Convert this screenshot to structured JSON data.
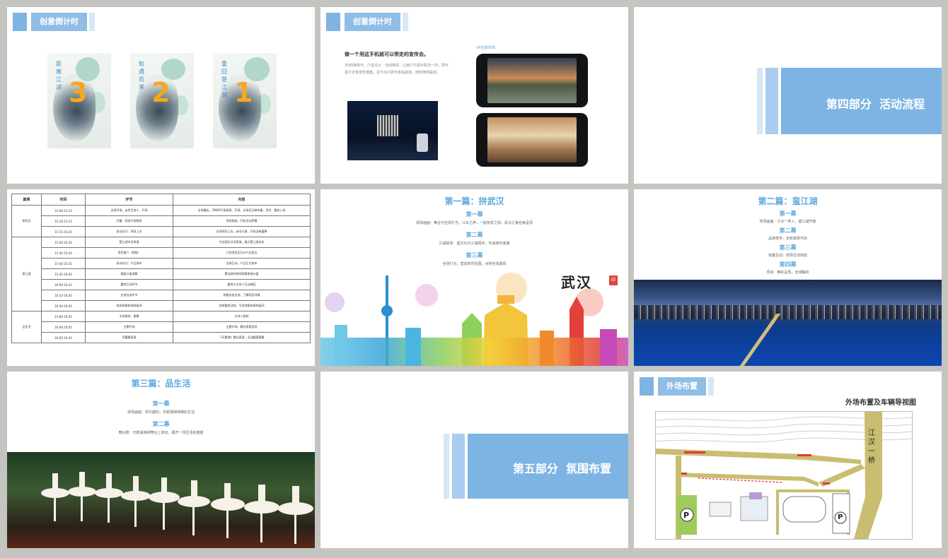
{
  "slide1": {
    "tag": "创意倒计时",
    "cards": [
      {
        "number": "3",
        "vtext": "距离江湖"
      },
      {
        "number": "2",
        "vtext": "知遇而来"
      },
      {
        "number": "1",
        "vtext": "重回楚江湖"
      }
    ]
  },
  "slide2": {
    "tag": "创意倒计时",
    "headline": "做一个用这手机就可以带走的宣传会。",
    "body": "3D的特效与、户型设计、活动等现，让用户只需手机扫一扫，即可进行全景浏览楼盘，足不出户即可身临其境，随时随地看房。",
    "phone_caption": "VR全景现场"
  },
  "slide3": {
    "title": "第四部分  活动流程"
  },
  "slide4": {
    "headers": [
      "篇章",
      "时间",
      "环节",
      "内容"
    ],
    "groups": [
      {
        "name": "拼武汉",
        "rows": [
          {
            "time": "15:00-15:10",
            "step": "全场开场、走秀主持人、开场",
            "content": "全场播出、ZWKP开场表演、开场、全场武汉城市篇、宣传、嘉宾入场"
          },
          {
            "time": "15:10-15:15",
            "step": "开篇：领导开场致辞",
            "content": "领导致辞，开启活动序幕"
          },
          {
            "time": "15:15-15:20",
            "step": "启动仪式：领导上台",
            "content": "全场领导上台，启动大屏，开启全新篇章"
          }
        ]
      },
      {
        "name": "蛮江湖",
        "rows": [
          {
            "time": "15:20-15:30",
            "step": "楚江湖节目表演",
            "content": "专业团队节目表演，展示楚江湖文化"
          },
          {
            "time": "15:30-15:40",
            "step": "项目推介（视频）",
            "content": "介绍项目区位与产品亮点"
          },
          {
            "time": "15:40-15:45",
            "step": "启动仪式：产品发布",
            "content": "全场互动，产品正式发布"
          },
          {
            "time": "15:45-16:00",
            "step": "楼盘沙盘讲解",
            "content": "置业顾问带领宾客参观沙盘"
          },
          {
            "time": "16:00-16:10",
            "step": "嘉宾互动环节",
            "content": "嘉宾与主持人互动抽奖"
          },
          {
            "time": "16:10-16:40",
            "step": "交流洽谈环节",
            "content": "宾客自由交流，了解项目详情"
          },
          {
            "time": "16:40-16:60",
            "step": "现场宾客参观样板间",
            "content": "安排看房动线，引导宾客参观样板间"
          }
        ]
      },
      {
        "name": "品生活",
        "rows": [
          {
            "time": "15:60-16:00",
            "step": "主持致辞、谢幕",
            "content": "主持人致辞"
          },
          {
            "time": "16:00-16:05",
            "step": "主题开场",
            "content": "主题开场，舞台表演呈现"
          },
          {
            "time": "16:05-16:30",
            "step": "芭蕾舞表演",
            "content": "《天鹅湖》舞台表演，活动圆满落幕"
          }
        ]
      }
    ]
  },
  "slide5": {
    "title": "第一篇：拼武汉",
    "sections": [
      {
        "heading": "第一幕",
        "text": "现场画面：舞台与全场灯光，江水之声，一股热爱之情，武汉之美完美呈现"
      },
      {
        "heading": "第二幕",
        "text": "江湖故事：楚文化与江湖情怀，传递城市底蕴"
      },
      {
        "heading": "第三幕",
        "text": "全场灯光，营造热烈氛围，点燃全场激情"
      }
    ],
    "calligraphy": "武汉",
    "seal": "印"
  },
  "slide6": {
    "title": "第二篇：蛮江湖",
    "sections": [
      {
        "heading": "第一幕",
        "text": "现场画面：江水一条入，楚江湖开篇"
      },
      {
        "heading": "第二幕",
        "text": "品牌发布：全新篇章开启"
      },
      {
        "heading": "第三幕",
        "text": "有趣互动：现场互动体验"
      },
      {
        "heading": "第四幕",
        "text": "项目：精彩呈现，全城瞩目"
      }
    ]
  },
  "slide7": {
    "title": "第三篇：品生活",
    "sections": [
      {
        "heading": "第一幕",
        "text": "现场画面：情与趣的，天鹅湖演绎精彩生活"
      },
      {
        "heading": "第二幕",
        "text": "舞台剧：天鹅湖演绎舞台上演出，展开一场生活的盛宴"
      }
    ]
  },
  "slide8": {
    "title": "第五部分  氛围布置"
  },
  "slide9": {
    "tag": "外场布置",
    "title": "外场布置及车辆导视图",
    "road_label": "江汉一桥",
    "parking_symbol": "P"
  },
  "colors": {
    "accent": "#7db4e3",
    "title_blue": "#5aa8dc",
    "countdown_orange": "#f5a81d",
    "road_olive": "#c9bd72",
    "parking_green": "#9ccc5c"
  }
}
